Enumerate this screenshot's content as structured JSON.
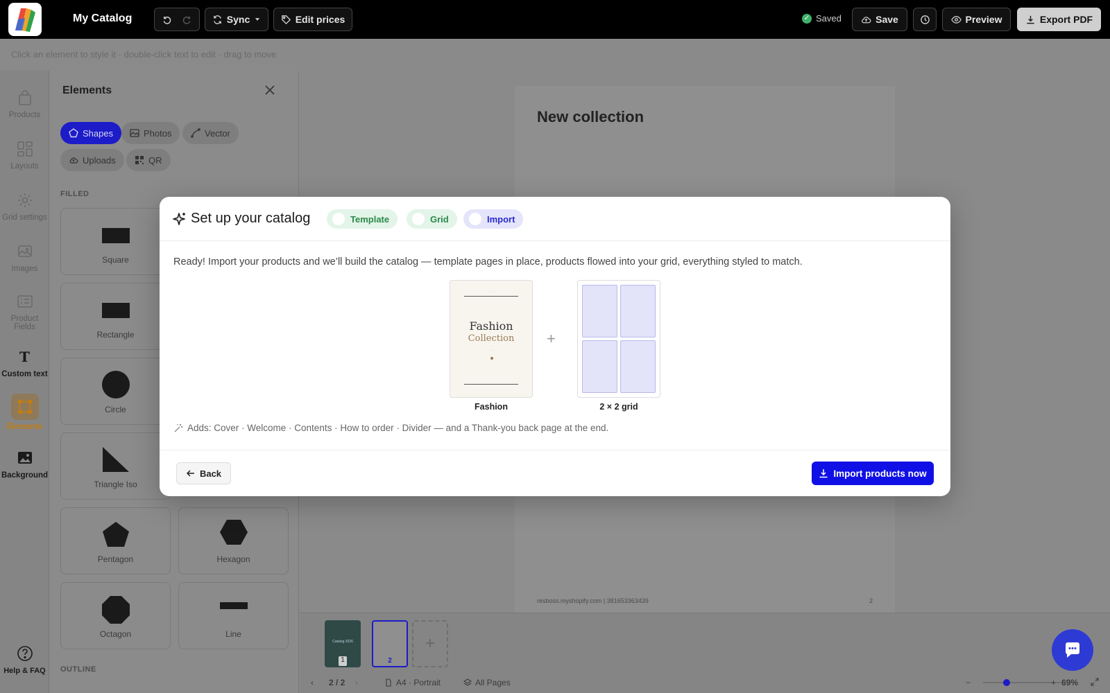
{
  "app": {
    "title": "My Catalog",
    "sync_label": "Sync",
    "edit_prices_label": "Edit prices",
    "saved_label": "Saved",
    "save_label": "Save",
    "preview_label": "Preview",
    "export_label": "Export PDF"
  },
  "hint": "Click an element to style it · double-click text to edit · drag to move",
  "rail": {
    "items": [
      {
        "label": "Products",
        "icon": "bag-icon"
      },
      {
        "label": "Layouts",
        "icon": "layout-icon"
      },
      {
        "label": "Grid settings",
        "icon": "gear-icon"
      },
      {
        "label": "Images",
        "icon": "images-icon"
      },
      {
        "label": "Product Fields",
        "icon": "fields-icon"
      },
      {
        "label": "Custom text",
        "icon": "text-icon"
      },
      {
        "label": "Elements",
        "icon": "elements-icon"
      },
      {
        "label": "Background",
        "icon": "background-icon"
      }
    ],
    "help_label": "Help & FAQ"
  },
  "panel": {
    "title": "Elements",
    "chips": [
      "Shapes",
      "Photos",
      "Vector",
      "Uploads",
      "QR"
    ],
    "filled_label": "FILLED",
    "outline_label": "OUTLINE",
    "shapes": [
      "Square",
      "Rectangle",
      "Circle",
      "Triangle Iso",
      "Pentagon",
      "Hexagon",
      "Octagon",
      "Line"
    ]
  },
  "canvas": {
    "page_title": "New collection",
    "footer": "resboss.myshopify.com | 381653363439",
    "page_number": "2"
  },
  "thumbs": {
    "thumb1_text": "Catalog 2026",
    "thumb1_num": "1",
    "thumb2_num": "2",
    "add": "+"
  },
  "status": {
    "pages": "2 / 2",
    "format": "A4 · Portrait",
    "all_pages": "All Pages",
    "zoom_minus": "−",
    "zoom_plus": "+",
    "zoom": "69%",
    "zoom_fraction": 0.3
  },
  "modal": {
    "title": "Set up your catalog",
    "steps": [
      "Template",
      "Grid",
      "Import"
    ],
    "description": "Ready! Import your products and we’ll build the catalog — template pages in place, products flowed into your grid, everything styled to match.",
    "template_name": "Fashion",
    "template_line1": "Fashion",
    "template_line2": "Collection",
    "grid_name": "2 × 2 grid",
    "plus": "+",
    "adds": "Adds: Cover · Welcome · Contents · How to order · Divider — and a Thank-you back page at the end.",
    "back_label": "Back",
    "import_label": "Import products now"
  },
  "colors": {
    "accent": "#1010e6",
    "done_step": "#2b8a4b",
    "elements_active": "#c27d12"
  }
}
